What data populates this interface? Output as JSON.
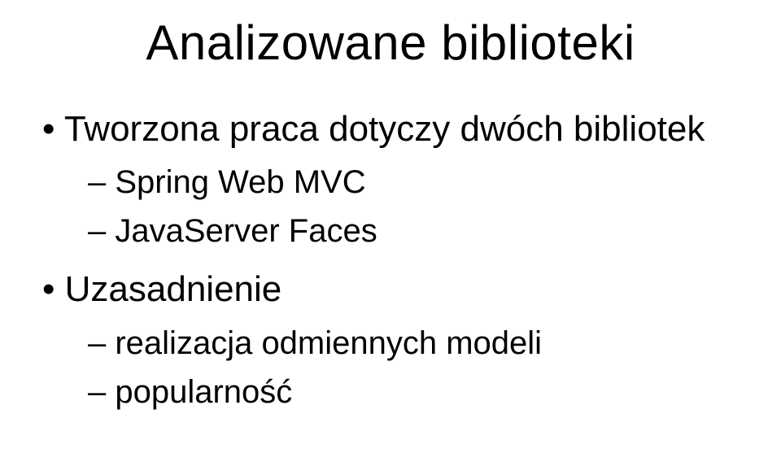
{
  "title": "Analizowane biblioteki",
  "bullets": [
    {
      "text": "Tworzona praca dotyczy dwóch bibliotek",
      "sub": [
        {
          "text": "Spring Web MVC"
        },
        {
          "text": "JavaServer Faces"
        }
      ]
    },
    {
      "text": "Uzasadnienie",
      "sub": [
        {
          "text": "realizacja odmiennych modeli"
        },
        {
          "text": "popularność"
        }
      ]
    }
  ]
}
